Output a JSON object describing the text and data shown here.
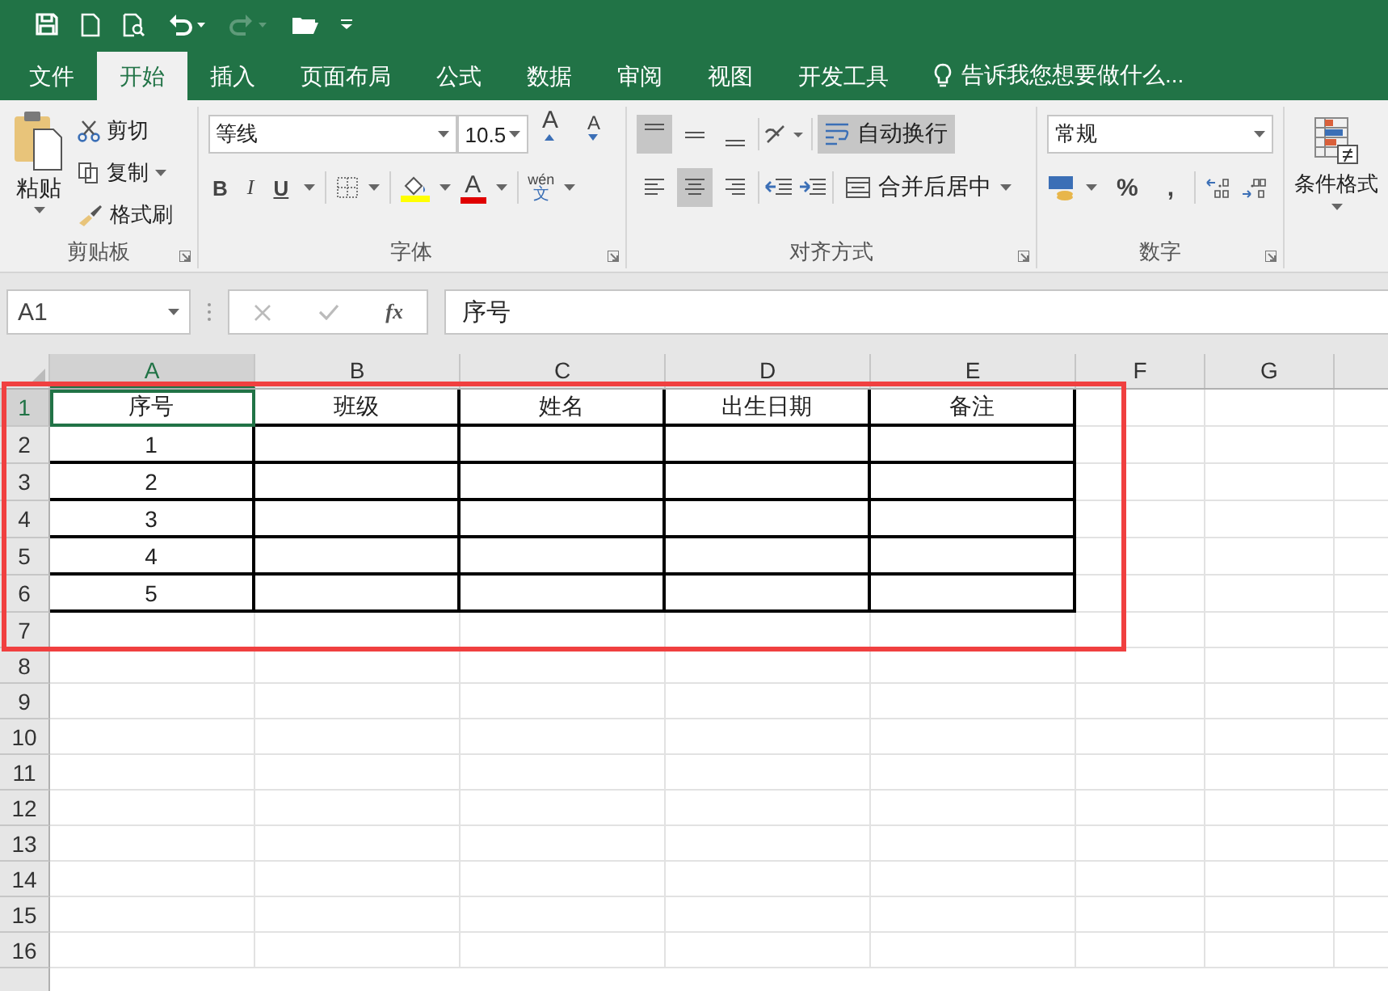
{
  "quick_access": [
    {
      "kind": "save",
      "disabled": false
    },
    {
      "kind": "new",
      "disabled": false
    },
    {
      "kind": "preview",
      "disabled": false
    },
    {
      "kind": "undo",
      "disabled": false
    },
    {
      "kind": "redo",
      "disabled": true
    },
    {
      "kind": "open",
      "disabled": false
    },
    {
      "kind": "customize",
      "disabled": false
    }
  ],
  "tabs": [
    {
      "label": "文件",
      "selected": false
    },
    {
      "label": "开始",
      "selected": true
    },
    {
      "label": "插入",
      "selected": false
    },
    {
      "label": "页面布局",
      "selected": false
    },
    {
      "label": "公式",
      "selected": false
    },
    {
      "label": "数据",
      "selected": false
    },
    {
      "label": "审阅",
      "selected": false
    },
    {
      "label": "视图",
      "selected": false
    },
    {
      "label": "开发工具",
      "selected": false
    }
  ],
  "tell_me": "告诉我您想要做什么...",
  "ribbon": {
    "clipboard": {
      "label": "剪贴板",
      "paste": "粘贴",
      "cut": "剪切",
      "copy": "复制",
      "format_painter": "格式刷"
    },
    "font": {
      "label": "字体",
      "font_name": "等线",
      "font_size": "10.5",
      "grow": "A",
      "shrink": "A",
      "bold": "B",
      "italic": "I",
      "underline": "U",
      "font_color": "A",
      "phonetic_top": "wén",
      "phonetic_bottom": "文"
    },
    "alignment": {
      "label": "对齐方式",
      "vertical": [
        {
          "kind": "top",
          "selected": true
        },
        {
          "kind": "middle",
          "selected": false
        },
        {
          "kind": "bottom",
          "selected": false
        }
      ],
      "horizontal": [
        {
          "kind": "left",
          "selected": false
        },
        {
          "kind": "center",
          "selected": true
        },
        {
          "kind": "right",
          "selected": false
        }
      ],
      "wrap_text": {
        "label": "自动换行",
        "on": true
      },
      "merge": "合并后居中"
    },
    "number": {
      "label": "数字",
      "format": "常规",
      "percent": "%",
      "comma": ","
    },
    "styles": {
      "conditional_format": "条件格式"
    }
  },
  "formula_bar": {
    "name_box": "A1",
    "fx": "fx",
    "value": "序号"
  },
  "sheet": {
    "columns": [
      {
        "label": "A",
        "selected": true
      },
      {
        "label": "B",
        "selected": false
      },
      {
        "label": "C",
        "selected": false
      },
      {
        "label": "D",
        "selected": false
      },
      {
        "label": "E",
        "selected": false
      },
      {
        "label": "F",
        "selected": false
      },
      {
        "label": "G",
        "selected": false
      }
    ],
    "rows": [
      {
        "header": "1",
        "selected": true,
        "bordered": true,
        "cells": [
          {
            "text": "序号",
            "selected": true
          },
          {
            "text": "班级",
            "selected": false
          },
          {
            "text": "姓名",
            "selected": false
          },
          {
            "text": "出生日期",
            "selected": false
          },
          {
            "text": "备注",
            "selected": false
          }
        ]
      },
      {
        "header": "2",
        "selected": false,
        "bordered": true,
        "cells": [
          {
            "text": "1",
            "selected": false
          }
        ]
      },
      {
        "header": "3",
        "selected": false,
        "bordered": true,
        "cells": [
          {
            "text": "2",
            "selected": false
          }
        ]
      },
      {
        "header": "4",
        "selected": false,
        "bordered": true,
        "cells": [
          {
            "text": "3",
            "selected": false
          }
        ]
      },
      {
        "header": "5",
        "selected": false,
        "bordered": true,
        "cells": [
          {
            "text": "4",
            "selected": false
          }
        ]
      },
      {
        "header": "6",
        "selected": false,
        "bordered": true,
        "cells": [
          {
            "text": "5",
            "selected": false
          }
        ]
      },
      {
        "header": "7",
        "selected": false,
        "bordered": false
      },
      {
        "header": "8",
        "selected": false,
        "bordered": false
      },
      {
        "header": "9",
        "selected": false,
        "bordered": false
      },
      {
        "header": "10",
        "selected": false,
        "bordered": false
      },
      {
        "header": "11",
        "selected": false,
        "bordered": false
      },
      {
        "header": "12",
        "selected": false,
        "bordered": false
      },
      {
        "header": "13",
        "selected": false,
        "bordered": false
      },
      {
        "header": "14",
        "selected": false,
        "bordered": false
      },
      {
        "header": "15",
        "selected": false,
        "bordered": false
      },
      {
        "header": "16",
        "selected": false,
        "bordered": false
      }
    ]
  }
}
